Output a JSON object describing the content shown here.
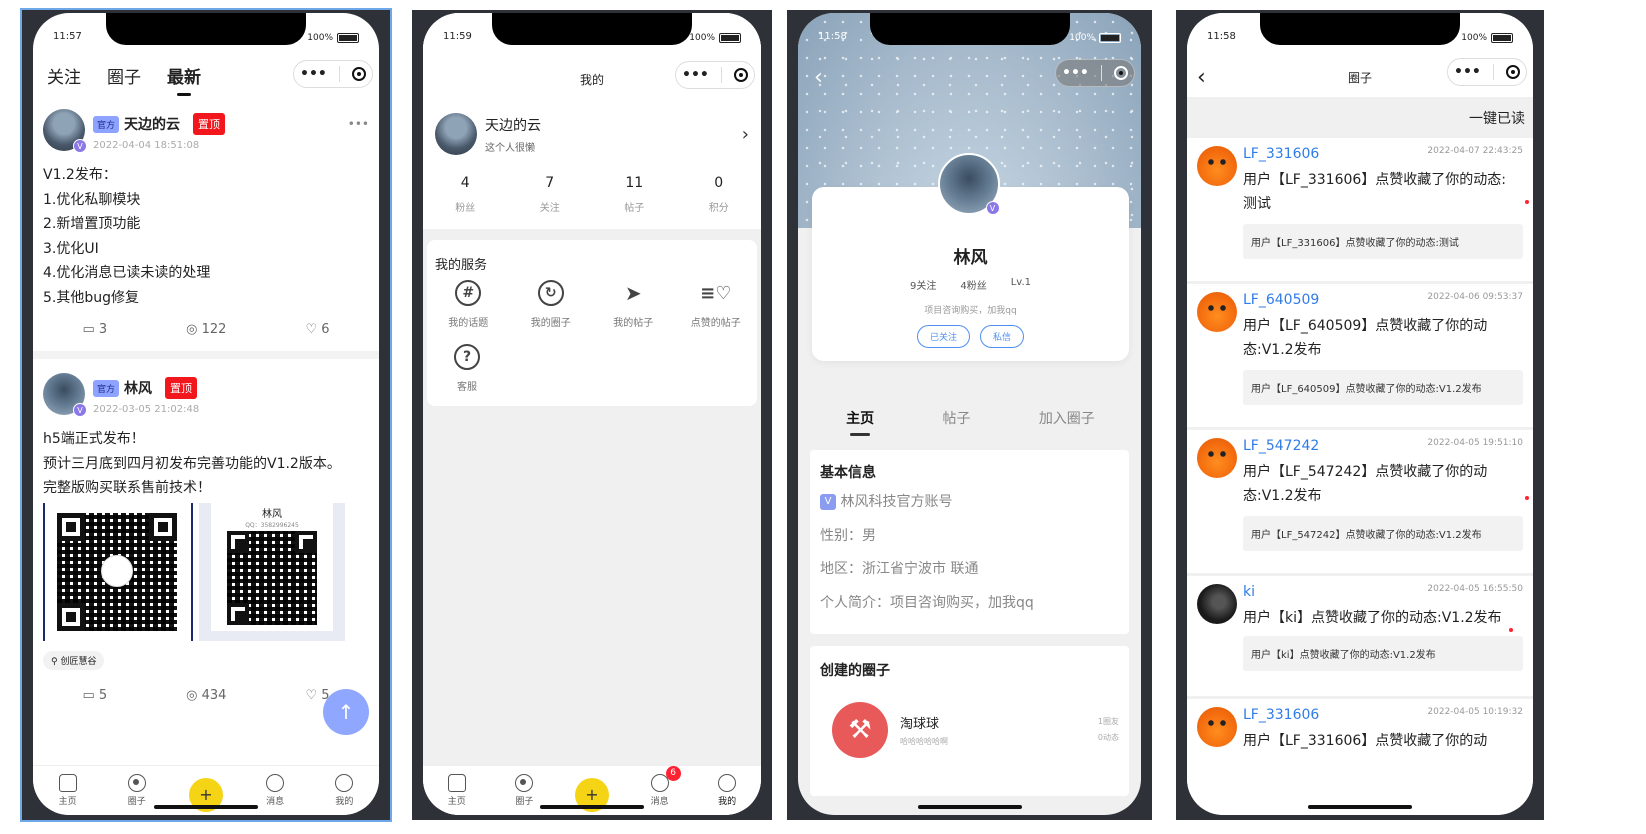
{
  "status": {
    "p1_time": "11:57",
    "p2_time": "11:59",
    "p3_time": "11:58",
    "p4_time": "11:58",
    "battery": "100%"
  },
  "tabbar": {
    "home": "主页",
    "circle": "圈子",
    "plus": "+",
    "messages": "消息",
    "mine": "我的",
    "msg_badge": "6"
  },
  "feed": {
    "tabs": [
      "关注",
      "圈子",
      "最新"
    ],
    "posts": [
      {
        "official": "官方",
        "author": "天边的云",
        "pinned": "置顶",
        "time": "2022-04-04 18:51:08",
        "lines": [
          "V1.2发布：",
          "1.优化私聊模块",
          "2.新增置顶功能",
          "3.优化UI",
          "4.优化消息已读未读的处理",
          "5.其他bug修复"
        ],
        "comments": "3",
        "views": "122",
        "likes": "6"
      },
      {
        "official": "官方",
        "author": "林风",
        "pinned": "置顶",
        "time": "2022-03-05 21:02:48",
        "lines": [
          "h5端正式发布！",
          "预计三月底到四月初发布完善功能的V1.2版本。",
          "完整版购买联系售前技术！"
        ],
        "qr_name": "林风",
        "qr_sub": "QQ：3582996245",
        "location": "创匠慧谷",
        "comments": "5",
        "views": "434",
        "likes": "5"
      }
    ],
    "more": "•••"
  },
  "mine": {
    "title": "我的",
    "username": "天边的云",
    "bio": "这个人很懒",
    "stats": [
      {
        "num": "4",
        "label": "粉丝"
      },
      {
        "num": "7",
        "label": "关注"
      },
      {
        "num": "11",
        "label": "帖子"
      },
      {
        "num": "0",
        "label": "积分"
      }
    ],
    "services_title": "我的服务",
    "services": [
      "我的话题",
      "我的圈子",
      "我的帖子",
      "点赞的帖子",
      "客服"
    ]
  },
  "profile": {
    "name": "林风",
    "follows": "9关注",
    "fans": "4粉丝",
    "level": "Lv.1",
    "desc": "项目咨询购买，加我qq",
    "btn_followed": "已关注",
    "btn_message": "私信",
    "tabs": [
      "主页",
      "帖子",
      "加入圈子"
    ],
    "basic_title": "基本信息",
    "verified": "林风科技官方账号",
    "gender": "性别：男",
    "region": "地区：浙江省宁波市 联通",
    "intro": "个人简介：项目咨询购买，加我qq",
    "circles_title": "创建的圈子",
    "circle_name": "淘球球",
    "circle_desc": "哈哈哈哈哈啊",
    "circle_members": "1圈友",
    "circle_posts": "0动态"
  },
  "notifications": {
    "title": "圈子",
    "mark_all": "一键已读",
    "items": [
      {
        "user": "LF_331606",
        "time": "2022-04-07 22:43:25",
        "text": "用户【LF_331606】点赞收藏了你的动态:",
        "text2": "测试",
        "quote": "用户【LF_331606】点赞收藏了你的动态:测试"
      },
      {
        "user": "LF_640509",
        "time": "2022-04-06 09:53:37",
        "text": "用户【LF_640509】点赞收藏了你的动",
        "text2": "态:V1.2发布",
        "quote": "用户【LF_640509】点赞收藏了你的动态:V1.2发布"
      },
      {
        "user": "LF_547242",
        "time": "2022-04-05 19:51:10",
        "text": "用户【LF_547242】点赞收藏了你的动",
        "text2": "态:V1.2发布",
        "quote": "用户【LF_547242】点赞收藏了你的动态:V1.2发布"
      },
      {
        "user": "ki",
        "time": "2022-04-05 16:55:50",
        "text": "用户【ki】点赞收藏了你的动态:V1.2发布",
        "text2": "",
        "quote": "用户【ki】点赞收藏了你的动态:V1.2发布"
      },
      {
        "user": "LF_331606",
        "time": "2022-04-05 10:19:32",
        "text": "用户【LF_331606】点赞收藏了你的动",
        "text2": "",
        "quote": ""
      }
    ]
  },
  "colors": {
    "accent_yellow": "#f5d416",
    "pinned_red": "#f2161d",
    "official_blue": "#8da3ff",
    "link_blue": "#2f7be8",
    "fab_blue": "#8fa7ff"
  }
}
